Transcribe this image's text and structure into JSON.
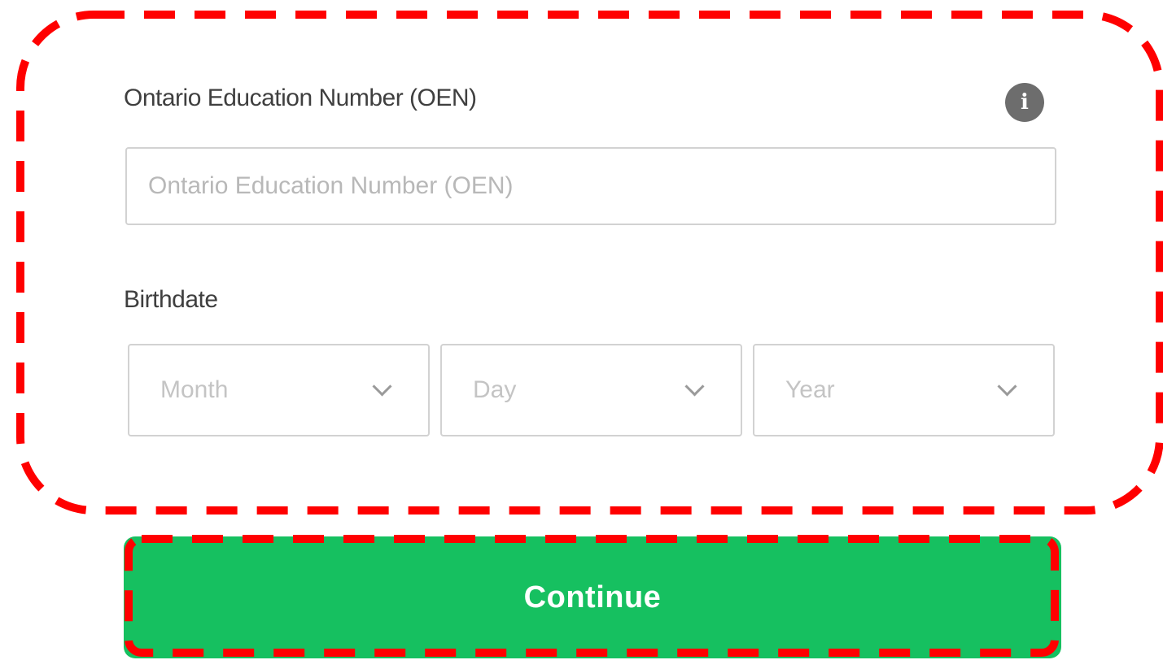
{
  "form": {
    "oen_label": "Ontario Education Number (OEN)",
    "oen_placeholder": "Ontario Education Number (OEN)",
    "oen_value": "",
    "info_icon": "info-icon",
    "info_glyph": "i",
    "birthdate_label": "Birthdate",
    "month_value": "Month",
    "day_value": "Day",
    "year_value": "Year",
    "chevron_icon": "chevron-down-icon"
  },
  "actions": {
    "continue_label": "Continue"
  },
  "colors": {
    "primary_button": "#16c060",
    "highlight_outline": "#ff0000",
    "info_icon_bg": "#6d6d6d"
  }
}
